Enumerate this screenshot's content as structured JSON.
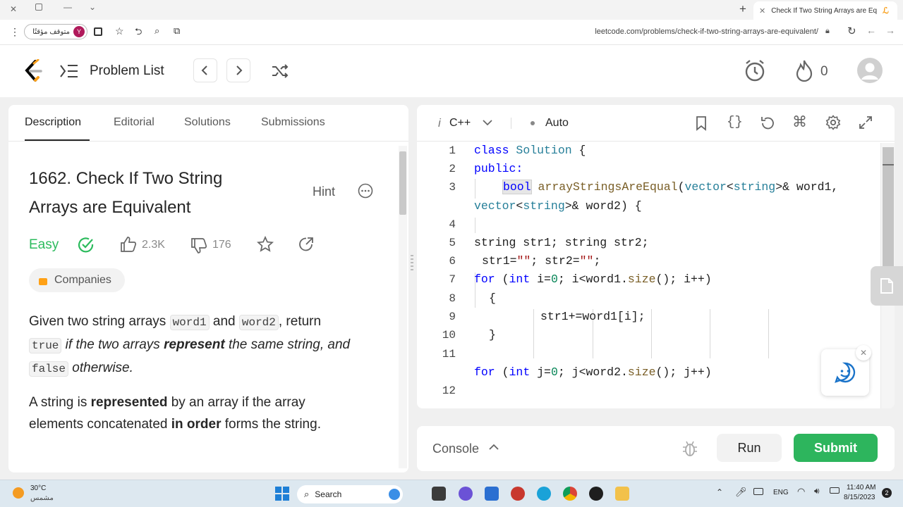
{
  "browser": {
    "tab_title": "Check If Two String Arrays are Eq",
    "profile_status": "متوقف مؤقتًا",
    "profile_initial": "Y",
    "url": "leetcode.com/problems/check-if-two-string-arrays-are-equivalent/"
  },
  "header": {
    "problem_list": "Problem List",
    "streak_count": "0"
  },
  "left": {
    "tabs": [
      "Description",
      "Editorial",
      "Solutions",
      "Submissions"
    ],
    "title_line1": "1662. Check If Two String",
    "title_line2": "Arrays are Equivalent",
    "hint": "Hint",
    "difficulty": "Easy",
    "likes": "2.3K",
    "dislikes": "176",
    "companies": "Companies",
    "p1": {
      "t1": "Given two string arrays ",
      "c1": "word1",
      "t2": " and ",
      "c2": "word2",
      "t3": ", return",
      "c3": "true",
      "t4": " if the two arrays ",
      "b1": "represent",
      "t5": " the same string, and",
      "c4": "false",
      "t6": " otherwise."
    },
    "p2": {
      "t1": "A string is ",
      "b1": "represented",
      "t2": " by an array if the array",
      "t3": "elements concatenated ",
      "b2": "in order",
      "t4": " forms the string."
    }
  },
  "editor": {
    "language": "C++",
    "mode": "Auto",
    "line_numbers": [
      "1",
      "2",
      "3",
      "4",
      "5",
      "6",
      "7",
      "8",
      "9",
      "10",
      "11",
      "12"
    ],
    "code": {
      "l1a": "class ",
      "l1b": "Solution",
      "l1c": " {",
      "l2": "public:",
      "l3a": "bool",
      "l3b": " ",
      "l3c": "arrayStringsAreEqual",
      "l3d": "(",
      "l3e": "vector",
      "l3f": "<",
      "l3g": "string",
      "l3h": ">& word1,",
      "l3i": "vector",
      "l3j": "<",
      "l3k": "string",
      "l3l": ">& word2) {",
      "l5": "string str1; string str2;",
      "l6a": "str1=",
      "l6b": "\"\"",
      "l6c": "; str2=",
      "l6d": "\"\"",
      "l6e": ";",
      "l7a": "for",
      "l7b": " (",
      "l7c": "int",
      "l7d": " i=",
      "l7e": "0",
      "l7f": "; i<word1.",
      "l7g": "size",
      "l7h": "(); i++)",
      "l8": "{",
      "l9": "str1+=word1[i];",
      "l10": "}",
      "l11a": "for",
      "l11b": " (",
      "l11c": "int",
      "l11d": " j=",
      "l11e": "0",
      "l11f": "; j<word2.",
      "l11g": "size",
      "l11h": "(); j++)"
    }
  },
  "console": {
    "label": "Console",
    "run": "Run",
    "submit": "Submit"
  },
  "taskbar": {
    "temp": "30°C",
    "weather": "مشمس",
    "search": "Search",
    "lang": "ENG",
    "time": "11:40 AM",
    "date": "8/15/2023",
    "notif": "2"
  },
  "colors": {
    "accent_green": "#2db55d",
    "easy_green": "#2cbb5d",
    "keyword_blue": "#0000ff",
    "type_teal": "#267f99"
  }
}
